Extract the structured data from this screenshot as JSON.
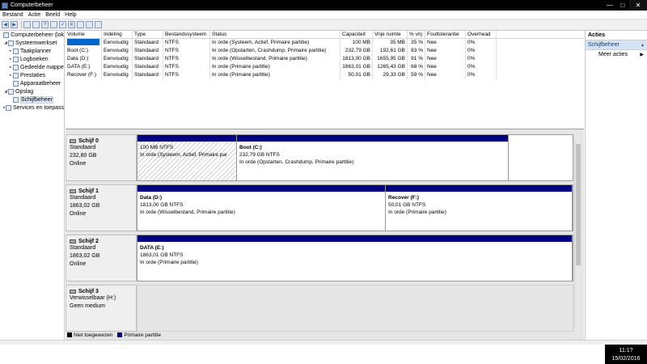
{
  "window": {
    "title": "Computerbeheer",
    "minimize": "—",
    "maximize": "□",
    "close": "✕"
  },
  "menu": [
    "Bestand",
    "Actie",
    "Beeld",
    "Help"
  ],
  "tree": [
    {
      "label": "Computerbeheer (lok",
      "level": 0,
      "arrow": "",
      "icon": "computer-icon"
    },
    {
      "label": "Systeemwerkset",
      "level": 1,
      "arrow": "◢",
      "icon": "tools-icon"
    },
    {
      "label": "Taakplanner",
      "level": 2,
      "arrow": "▸",
      "icon": "clock-icon"
    },
    {
      "label": "Logboeken",
      "level": 2,
      "arrow": "▸",
      "icon": "log-icon"
    },
    {
      "label": "Gedeelde mappe",
      "level": 2,
      "arrow": "▸",
      "icon": "shared-folder-icon"
    },
    {
      "label": "Prestaties",
      "level": 2,
      "arrow": "▸",
      "icon": "performance-icon"
    },
    {
      "label": "Apparaatbeheer",
      "level": 2,
      "arrow": "",
      "icon": "device-icon"
    },
    {
      "label": "Opslag",
      "level": 1,
      "arrow": "◢",
      "icon": "storage-icon"
    },
    {
      "label": "Schijfbeheer",
      "level": 2,
      "arrow": "",
      "icon": "disk-icon",
      "selected": true
    },
    {
      "label": "Services en toepass",
      "level": 1,
      "arrow": "▸",
      "icon": "services-icon"
    }
  ],
  "volumes": {
    "headers": [
      "Volume",
      "Indeling",
      "Type",
      "Bestandssysteem",
      "Status",
      "Capaciteit",
      "Vrije ruimte",
      "% vrij",
      "Fouttolerantie",
      "Overhead"
    ],
    "rows": [
      [
        "",
        "Eenvoudig",
        "Standaard",
        "NTFS",
        "In orde (Systeem, Actief, Primaire partitie)",
        "100 MB",
        "35 MB",
        "35 %",
        "Nee",
        "0%"
      ],
      [
        "Boot (C:)",
        "Eenvoudig",
        "Standaard",
        "NTFS",
        "In orde (Opstarten, Crashdump, Primaire partitie)",
        "232,79 GB",
        "192,61 GB",
        "83 %",
        "Nee",
        "0%"
      ],
      [
        "Data (D:)",
        "Eenvoudig",
        "Standaard",
        "NTFS",
        "In orde (Wisselbestand, Primaire partitie)",
        "1813,00 GB",
        "1655,95 GB",
        "91 %",
        "Nee",
        "0%"
      ],
      [
        "DATA (E:)",
        "Eenvoudig",
        "Standaard",
        "NTFS",
        "In orde (Primaire partitie)",
        "1863,01 GB",
        "1265,43 GB",
        "68 %",
        "Nee",
        "0%"
      ],
      [
        "Recover (F:)",
        "Eenvoudig",
        "Standaard",
        "NTFS",
        "In orde (Primaire partitie)",
        "50,01 GB",
        "29,33 GB",
        "59 %",
        "Nee",
        "0%"
      ]
    ]
  },
  "disks": [
    {
      "name": "Schijf 0",
      "type": "Standaard",
      "size": "232,80 GB",
      "state": "Online",
      "partitions": [
        {
          "name": "",
          "size": "100 MB NTFS",
          "status": "In orde (Systeem, Actief, Primaire par",
          "frac": 0.229,
          "hatch": true
        },
        {
          "name": "Boot  (C:)",
          "size": "232,79 GB NTFS",
          "status": "In orde (Opstarten, Crashdump, Primaire partitie)",
          "frac": 0.624,
          "hatch": false
        }
      ]
    },
    {
      "name": "Schijf 1",
      "type": "Standaard",
      "size": "1863,02 GB",
      "state": "Online",
      "partitions": [
        {
          "name": "Data  (D:)",
          "size": "1813,00 GB NTFS",
          "status": "In orde (Wisselbestand, Primaire partitie)",
          "frac": 0.57,
          "hatch": false
        },
        {
          "name": "Recover  (F:)",
          "size": "50,01 GB NTFS",
          "status": "In orde (Primaire partitie)",
          "frac": 0.43,
          "hatch": false
        }
      ]
    },
    {
      "name": "Schijf 2",
      "type": "Standaard",
      "size": "1863,02 GB",
      "state": "Online",
      "partitions": [
        {
          "name": "DATA  (E:)",
          "size": "1863,01 GB NTFS",
          "status": "In orde (Primaire partitie)",
          "frac": 1.0,
          "hatch": false
        }
      ]
    },
    {
      "name": "Schijf 3",
      "type": "Verwisselbaar (H:)",
      "size": "",
      "state": "Geen medium",
      "partitions": []
    }
  ],
  "legend": [
    {
      "label": "Niet toegewezen",
      "color": "#000000"
    },
    {
      "label": "Primaire partitie",
      "color": "#000080"
    }
  ],
  "actions": {
    "header": "Acties",
    "section": "Schijfbeheer",
    "item": "Meer acties"
  },
  "clock": {
    "time": "11:1?",
    "date": "15/02/2016"
  },
  "colors": {
    "partition_bar": "#000080",
    "selection": "#0066cc",
    "action_section": "#d4e2f2"
  }
}
